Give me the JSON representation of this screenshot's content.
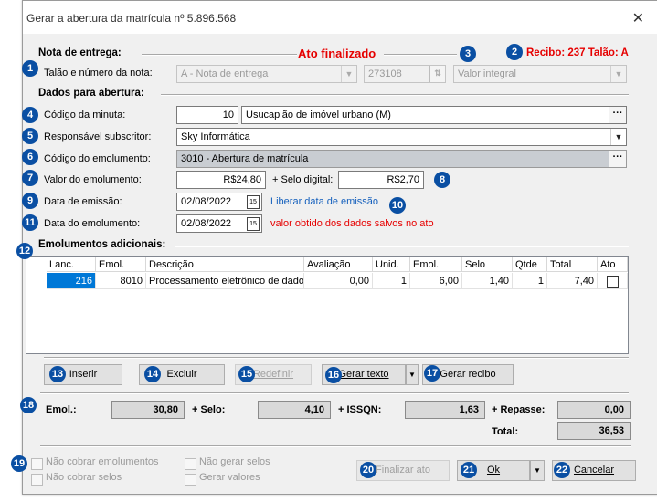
{
  "window": {
    "title": "Gerar a abertura da matrícula nº 5.896.568"
  },
  "header": {
    "status_text": "Ato finalizado",
    "receipt_text": "Recibo: 237 Talão: A"
  },
  "nota_entrega": {
    "section_label": "Nota de entrega:",
    "talao_label": "Talão e número da nota:",
    "talao_value": "A  - Nota de entrega",
    "numero_value": "273108",
    "valor_tipo_value": "Valor integral"
  },
  "dados_abertura": {
    "section_label": "Dados para abertura:",
    "minuta_label": "Código da minuta:",
    "minuta_code": "10",
    "minuta_desc": "Usucapião de imóvel urbano (M)",
    "responsavel_label": "Responsável subscritor:",
    "responsavel_value": "Sky Informática",
    "emolumento_code_label": "Código do emolumento:",
    "emolumento_code_value": "3010 - Abertura de matrícula",
    "valor_emol_label": "Valor do emolumento:",
    "valor_emol_value": "R$24,80",
    "selo_label": "+ Selo digital:",
    "selo_value": "R$2,70",
    "data_emissao_label": "Data de emissão:",
    "data_emissao_value": "02/08/2022",
    "liberar_link": "Liberar data de emissão",
    "data_emol_label": "Data do emolumento:",
    "data_emol_value": "02/08/2022",
    "data_emol_note": "valor obtido dos dados salvos no ato"
  },
  "adicionais": {
    "section_label": "Emolumentos adicionais:",
    "columns": [
      "Lanc.",
      "Emol.",
      "Descrição",
      "Avaliação",
      "Unid.",
      "Emol.",
      "Selo",
      "Qtde",
      "Total",
      "Ato"
    ],
    "rows": [
      {
        "lanc": "216",
        "emol": "8010",
        "descricao": "Processamento eletrônico de dados",
        "avaliacao": "0,00",
        "unid": "1",
        "emol_val": "6,00",
        "selo": "1,40",
        "qtde": "1",
        "total": "7,40"
      }
    ]
  },
  "grid_buttons": {
    "inserir": "Inserir",
    "excluir": "Excluir",
    "redefinir": "Redefinir",
    "gerar_texto": "Gerar texto",
    "gerar_recibo": "Gerar recibo"
  },
  "totais": {
    "emol_label": "Emol.:",
    "emol_value": "30,80",
    "selo_label": "+ Selo:",
    "selo_value": "4,10",
    "issqn_label": "+ ISSQN:",
    "issqn_value": "1,63",
    "repasse_label": "+ Repasse:",
    "repasse_value": "0,00",
    "total_label": "Total:",
    "total_value": "36,53"
  },
  "options": {
    "nao_cobrar_emol": "Não cobrar emolumentos",
    "nao_cobrar_selos": "Não cobrar selos",
    "nao_gerar_selos": "Não gerar selos",
    "gerar_valores": "Gerar valores"
  },
  "footer": {
    "finalizar": "Finalizar ato",
    "ok": "Ok",
    "cancelar": "Cancelar"
  },
  "badges": [
    "1",
    "2",
    "3",
    "4",
    "5",
    "6",
    "7",
    "8",
    "9",
    "10",
    "11",
    "12",
    "13",
    "14",
    "15",
    "16",
    "17",
    "18",
    "19",
    "20",
    "21",
    "22"
  ],
  "colors": {
    "badge": "#0a4fa3",
    "status_red": "#e60000",
    "link_blue": "#1560bd",
    "selected_blue": "#0078d7"
  }
}
